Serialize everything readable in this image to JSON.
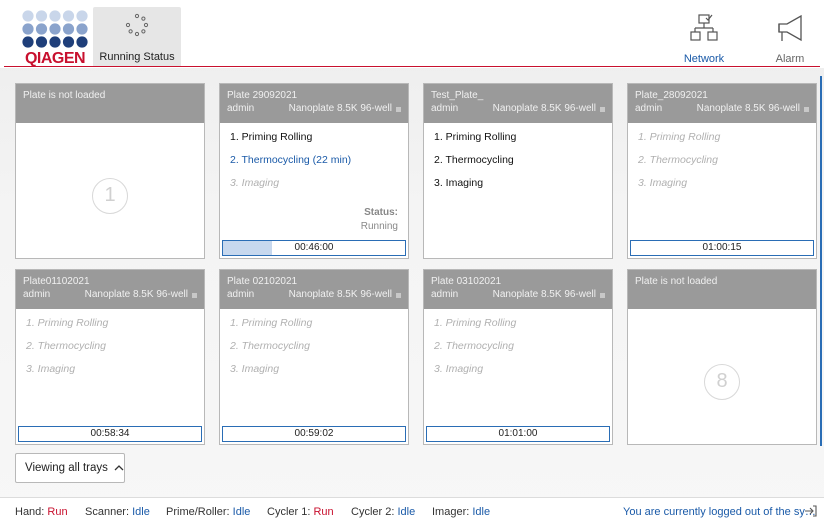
{
  "brand": {
    "logo_text": "QIAGEN",
    "accent": "#c8102e",
    "link_color": "#1a5aa8"
  },
  "header": {
    "active_tab": {
      "label": "Running Status",
      "icon": "running-dots-icon"
    },
    "nav": [
      {
        "label": "Network",
        "icon": "network-icon"
      },
      {
        "label": "Alarm",
        "icon": "megaphone-icon"
      }
    ]
  },
  "trays": [
    {
      "loaded": false,
      "header": "Plate is not loaded",
      "number": "1"
    },
    {
      "loaded": true,
      "plate": "Plate 29092021",
      "user": "admin",
      "type": "Nanoplate 8.5K 96-well",
      "steps": [
        {
          "label": "1. Priming Rolling",
          "state": "done"
        },
        {
          "label": "2. Thermocycling (22 min)",
          "state": "active"
        },
        {
          "label": "3. Imaging",
          "state": "pending"
        }
      ],
      "status_key": "Status:",
      "status_value": "Running",
      "timer": "00:46:00",
      "progress": 0.27
    },
    {
      "loaded": true,
      "plate": "Test_Plate_",
      "user": "admin",
      "type": "Nanoplate 8.5K 96-well",
      "steps": [
        {
          "label": "1. Priming Rolling",
          "state": "done"
        },
        {
          "label": "2. Thermocycling",
          "state": "done"
        },
        {
          "label": "3. Imaging",
          "state": "done"
        }
      ]
    },
    {
      "loaded": true,
      "plate": "Plate_28092021",
      "user": "admin",
      "type": "Nanoplate 8.5K 96-well",
      "steps": [
        {
          "label": "1. Priming Rolling",
          "state": "pending"
        },
        {
          "label": "2. Thermocycling",
          "state": "pending"
        },
        {
          "label": "3. Imaging",
          "state": "pending"
        }
      ],
      "timer": "01:00:15",
      "progress": 0
    },
    {
      "loaded": true,
      "plate": "Plate01102021",
      "user": "admin",
      "type": "Nanoplate 8.5K 96-well",
      "steps": [
        {
          "label": "1. Priming Rolling",
          "state": "pending"
        },
        {
          "label": "2. Thermocycling",
          "state": "pending"
        },
        {
          "label": "3. Imaging",
          "state": "pending"
        }
      ],
      "timer": "00:58:34",
      "progress": 0
    },
    {
      "loaded": true,
      "plate": "Plate 02102021",
      "user": "admin",
      "type": "Nanoplate 8.5K 96-well",
      "steps": [
        {
          "label": "1. Priming Rolling",
          "state": "pending"
        },
        {
          "label": "2. Thermocycling",
          "state": "pending"
        },
        {
          "label": "3. Imaging",
          "state": "pending"
        }
      ],
      "timer": "00:59:02",
      "progress": 0
    },
    {
      "loaded": true,
      "plate": "Plate 03102021",
      "user": "admin",
      "type": "Nanoplate 8.5K 96-well",
      "steps": [
        {
          "label": "1. Priming Rolling",
          "state": "pending"
        },
        {
          "label": "2. Thermocycling",
          "state": "pending"
        },
        {
          "label": "3. Imaging",
          "state": "pending"
        }
      ],
      "timer": "01:01:00",
      "progress": 0
    },
    {
      "loaded": false,
      "header": "Plate is not loaded",
      "number": "8"
    }
  ],
  "view_button": {
    "label": "Viewing all trays",
    "icon": "chevron-up-icon"
  },
  "footer": {
    "statuses": [
      {
        "key": "Hand:",
        "value": "Run",
        "tone": "run"
      },
      {
        "key": "Scanner:",
        "value": "Idle",
        "tone": "idle"
      },
      {
        "key": "Prime/Roller:",
        "value": "Idle",
        "tone": "idle"
      },
      {
        "key": "Cycler 1:",
        "value": "Run",
        "tone": "run"
      },
      {
        "key": "Cycler 2:",
        "value": "Idle",
        "tone": "idle"
      },
      {
        "key": "Imager:",
        "value": "Idle",
        "tone": "idle"
      }
    ],
    "message": "You are currently logged out of the sy…",
    "logout_icon": "logout-icon"
  }
}
